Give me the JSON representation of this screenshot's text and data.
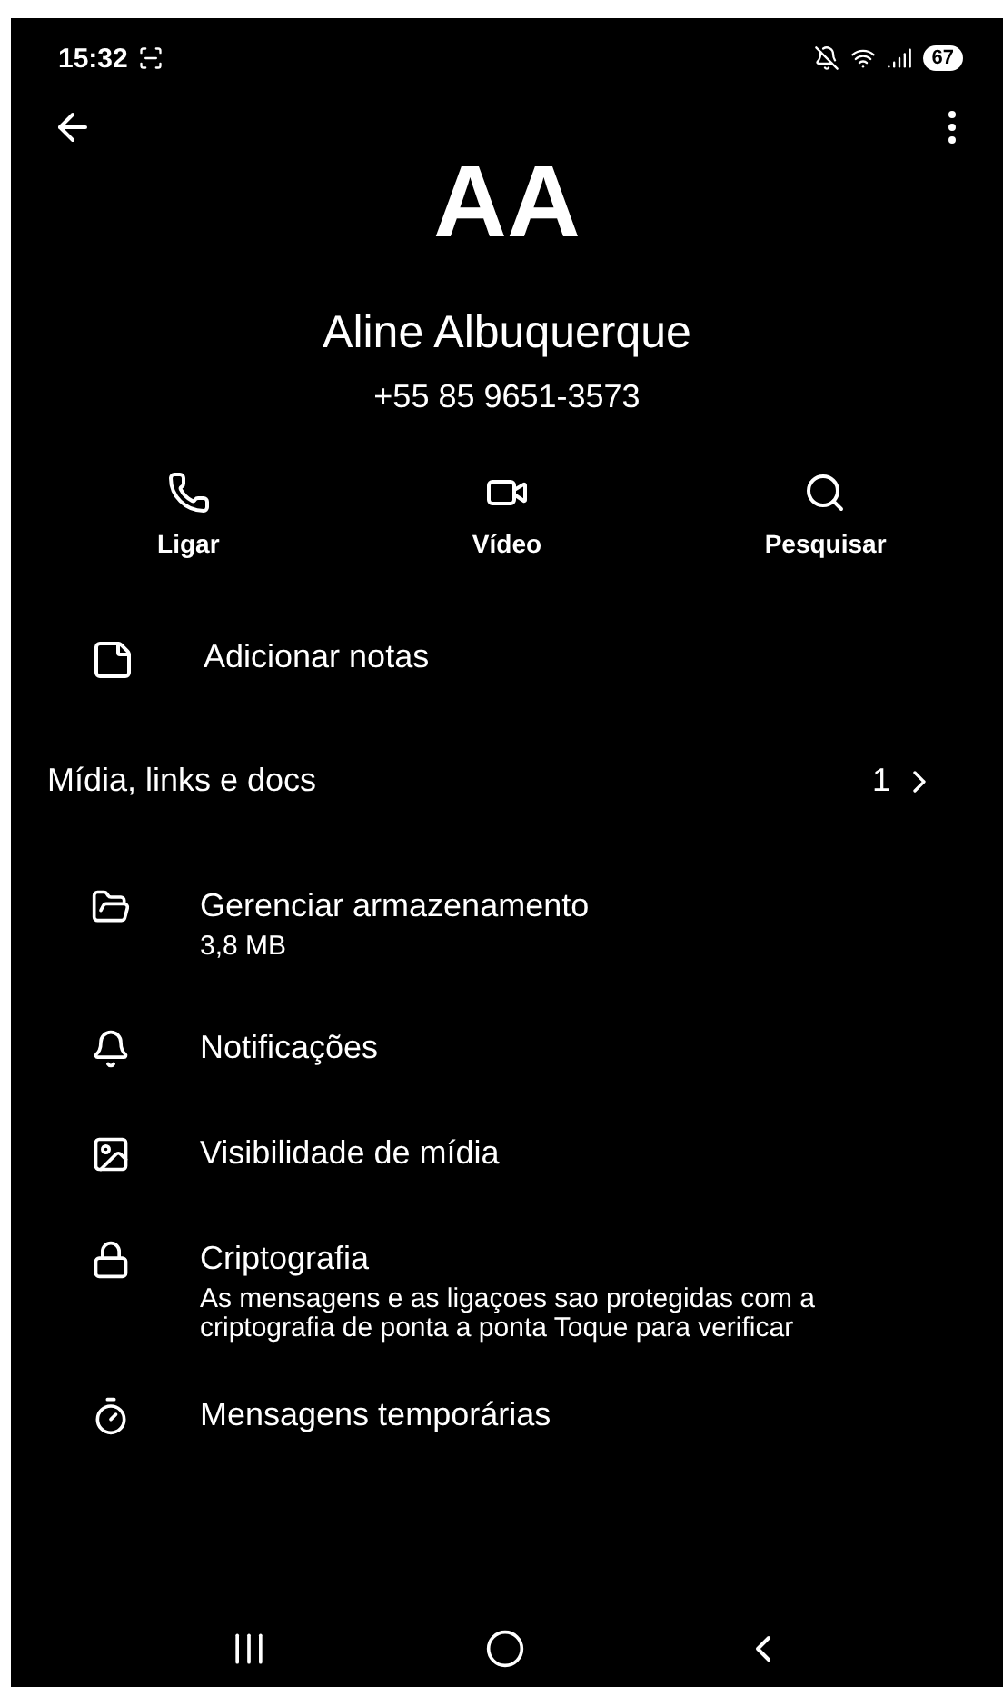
{
  "status_bar": {
    "time": "15:32",
    "battery": "67"
  },
  "contact": {
    "initials": "AA",
    "name": "Aline Albuquerque",
    "phone": "+55 85 9651-3573"
  },
  "actions": [
    {
      "kind": "call",
      "label": "Ligar"
    },
    {
      "kind": "video",
      "label": "Vídeo"
    },
    {
      "kind": "search",
      "label": "Pesquisar"
    }
  ],
  "notes": {
    "label": "Adicionar notas"
  },
  "media": {
    "label": "Mídia, links e docs",
    "count": "1"
  },
  "settings": [
    {
      "kind": "storage",
      "title": "Gerenciar armazenamento",
      "subtitle": "3,8 MB"
    },
    {
      "kind": "bell",
      "title": "Notificações"
    },
    {
      "kind": "image",
      "title": "Visibilidade de mídia"
    },
    {
      "kind": "lock",
      "title": "Criptografia",
      "subtitle": "As mensagens e as ligaçoes sao protegidas com a criptografia de ponta a ponta  Toque para verificar"
    },
    {
      "kind": "timer",
      "title": "Mensagens temporárias"
    }
  ]
}
